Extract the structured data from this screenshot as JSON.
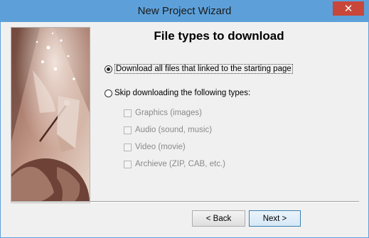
{
  "window": {
    "title": "New Project Wizard",
    "close_glyph": "✕"
  },
  "page": {
    "heading": "File types to download"
  },
  "options": {
    "download_all_label": "Download all files that linked to the starting page",
    "download_all_selected": true,
    "skip_label": "Skip downloading the following types:",
    "skip_selected": false
  },
  "filetypes": [
    {
      "label": "Graphics (images)",
      "checked": false,
      "enabled": false
    },
    {
      "label": "Audio (sound, music)",
      "checked": false,
      "enabled": false
    },
    {
      "label": "Video (movie)",
      "checked": false,
      "enabled": false
    },
    {
      "label": "Archieve (ZIP,  CAB, etc.)",
      "checked": false,
      "enabled": false
    }
  ],
  "buttons": {
    "back_label": "< Back",
    "next_label": "Next >"
  },
  "colors": {
    "titlebar": "#5da0d9",
    "close": "#c9463a",
    "illustration": "#9a6a5a"
  }
}
